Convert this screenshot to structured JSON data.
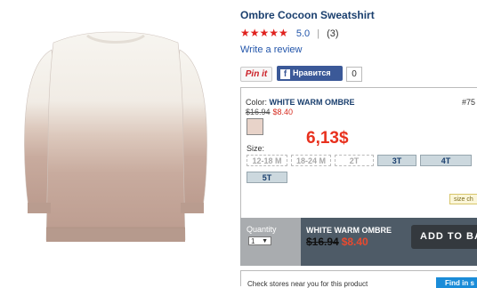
{
  "product": {
    "title": "Ombre Cocoon Sweatshirt",
    "stars": "★★★★★",
    "rating": "5.0",
    "separator": "|",
    "review_count": "(3)",
    "write_review": "Write a review"
  },
  "social": {
    "pin_label": "Pin it",
    "fb_icon": "f",
    "fb_label": "Нравится",
    "fb_count": "0"
  },
  "color": {
    "label": "Color: ",
    "name": "WHITE WARM OMBRE",
    "style_number": "#75",
    "old_price": "$16.94",
    "sale_price": "$8.40",
    "swatch_color": "#e8d3c9"
  },
  "annotation": {
    "price_local": "6,13$",
    "color": "#e8311e"
  },
  "sizes": {
    "label": "Size:",
    "options": [
      {
        "label": "12-18 M",
        "available": false
      },
      {
        "label": "18-24 M",
        "available": false
      },
      {
        "label": "2T",
        "available": false
      },
      {
        "label": "3T",
        "available": true
      },
      {
        "label": "4T",
        "available": true
      },
      {
        "label": "5T",
        "available": true
      }
    ],
    "size_chart": "size ch"
  },
  "purchase": {
    "quantity_label": "Quantity",
    "quantity_value": "1",
    "summary_color": "WHITE WARM OMBRE",
    "summary_old_price": "$16.94",
    "summary_sale_price": "$8.40",
    "add_to_bag": "ADD TO BA"
  },
  "store": {
    "text": "Check stores near you for this product",
    "find_button": "Find in s"
  }
}
